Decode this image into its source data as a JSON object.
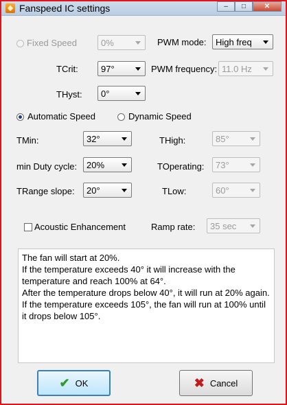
{
  "window": {
    "title": "Fanspeed IC settings"
  },
  "fixed_speed": {
    "label": "Fixed Speed",
    "value": "0%"
  },
  "pwm_mode": {
    "label": "PWM mode:",
    "value": "High freq"
  },
  "tcrit": {
    "label": "TCrit:",
    "value": "97°"
  },
  "pwm_frequency": {
    "label": "PWM frequency:",
    "value": "11.0 Hz"
  },
  "thyst": {
    "label": "THyst:",
    "value": "0°"
  },
  "automatic_speed": {
    "label": "Automatic Speed"
  },
  "dynamic_speed": {
    "label": "Dynamic Speed"
  },
  "tmin": {
    "label": "TMin:",
    "value": "32°"
  },
  "thigh": {
    "label": "THigh:",
    "value": "85°"
  },
  "min_duty": {
    "label": "min Duty cycle:",
    "value": "20%"
  },
  "toperating": {
    "label": "TOperating:",
    "value": "73°"
  },
  "trange": {
    "label": "TRange slope:",
    "value": "20°"
  },
  "tlow": {
    "label": "TLow:",
    "value": "60°"
  },
  "acoustic": {
    "label": "Acoustic Enhancement"
  },
  "ramp_rate": {
    "label": "Ramp rate:",
    "value": "35 sec"
  },
  "description": [
    "The fan will start at 20%.",
    "If the temperature exceeds 40° it will increase with the temperature and reach 100% at 64°.",
    "After the temperature drops below 40°, it will run at 20% again.",
    "If the temperature exceeds 105°, the fan will run at 100% until it drops below 105°."
  ],
  "buttons": {
    "ok": "OK",
    "cancel": "Cancel"
  },
  "icons": {
    "app": "fan-app-icon",
    "ok": "checkmark-icon",
    "cancel": "x-icon"
  },
  "colors": {
    "frame_border": "#e0121a",
    "ok_icon": "#2f9a2f",
    "cancel_icon": "#c21a1a"
  }
}
